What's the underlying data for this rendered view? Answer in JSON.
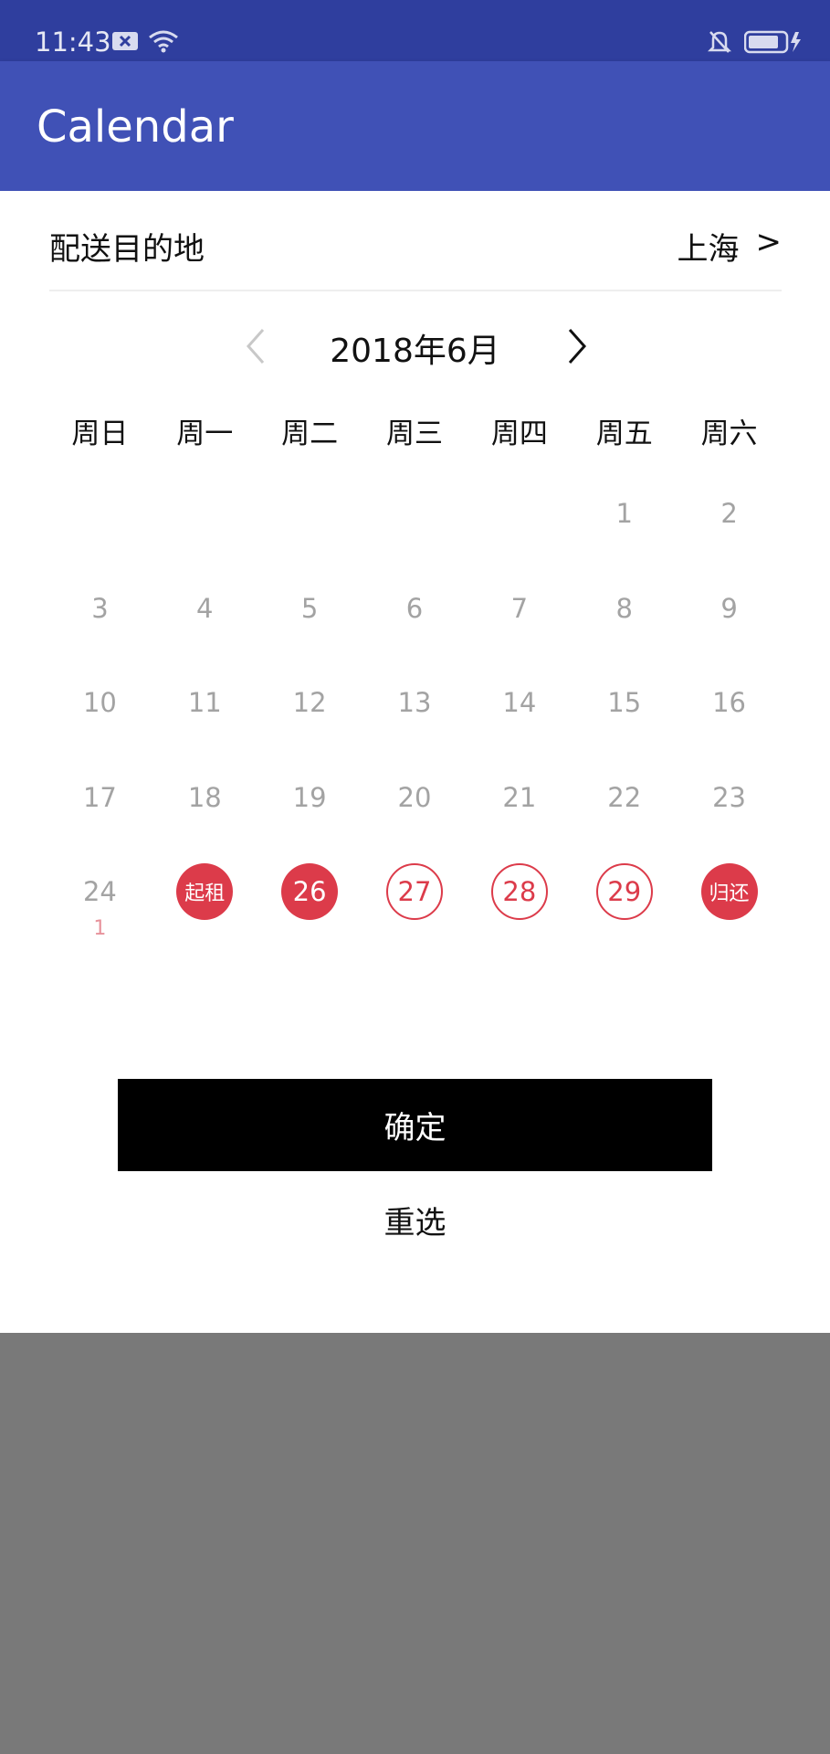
{
  "status_bar": {
    "time": "11:43"
  },
  "app_bar": {
    "title": "Calendar"
  },
  "destination": {
    "label": "配送目的地",
    "value": "上海",
    "chevron": ">"
  },
  "calendar": {
    "month_label": "2018年6月",
    "weekdays": [
      "周日",
      "周一",
      "周二",
      "周三",
      "周四",
      "周五",
      "周六"
    ],
    "weeks": [
      [
        {
          "label": ""
        },
        {
          "label": ""
        },
        {
          "label": ""
        },
        {
          "label": ""
        },
        {
          "label": ""
        },
        {
          "label": "1",
          "state": "disabled"
        },
        {
          "label": "2",
          "state": "disabled"
        }
      ],
      [
        {
          "label": "3",
          "state": "disabled"
        },
        {
          "label": "4",
          "state": "disabled"
        },
        {
          "label": "5",
          "state": "disabled"
        },
        {
          "label": "6",
          "state": "disabled"
        },
        {
          "label": "7",
          "state": "disabled"
        },
        {
          "label": "8",
          "state": "disabled"
        },
        {
          "label": "9",
          "state": "disabled"
        }
      ],
      [
        {
          "label": "10",
          "state": "disabled"
        },
        {
          "label": "11",
          "state": "disabled"
        },
        {
          "label": "12",
          "state": "disabled"
        },
        {
          "label": "13",
          "state": "disabled"
        },
        {
          "label": "14",
          "state": "disabled"
        },
        {
          "label": "15",
          "state": "disabled"
        },
        {
          "label": "16",
          "state": "disabled"
        }
      ],
      [
        {
          "label": "17",
          "state": "disabled"
        },
        {
          "label": "18",
          "state": "disabled"
        },
        {
          "label": "19",
          "state": "disabled"
        },
        {
          "label": "20",
          "state": "disabled"
        },
        {
          "label": "21",
          "state": "disabled"
        },
        {
          "label": "22",
          "state": "disabled"
        },
        {
          "label": "23",
          "state": "disabled"
        }
      ],
      [
        {
          "label": "24",
          "sub": "1",
          "state": "disabled"
        },
        {
          "label": "起租",
          "state": "selected"
        },
        {
          "label": "26",
          "state": "selected"
        },
        {
          "label": "27",
          "state": "range"
        },
        {
          "label": "28",
          "state": "range"
        },
        {
          "label": "29",
          "state": "range"
        },
        {
          "label": "归还",
          "state": "selected"
        }
      ]
    ]
  },
  "actions": {
    "confirm": "确定",
    "reset": "重选"
  },
  "colors": {
    "primary": "#4051b6",
    "status_bar": "#2f3e9e",
    "accent": "#dc3b4a",
    "overlay": "#797979"
  }
}
